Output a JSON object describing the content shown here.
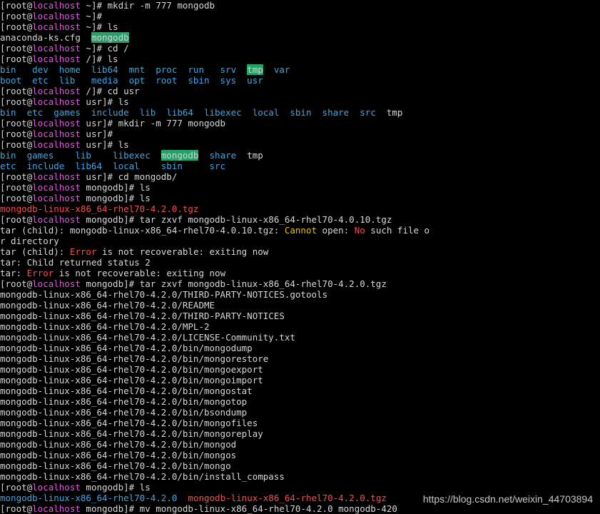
{
  "terminal": {
    "lines": [
      [
        {
          "t": "[root@"
        },
        {
          "t": "localhost",
          "c": "host"
        },
        {
          "t": " ~]# mkdir -m 777 mongodb"
        }
      ],
      [
        {
          "t": "[root@"
        },
        {
          "t": "localhost",
          "c": "host"
        },
        {
          "t": " ~]#"
        }
      ],
      [
        {
          "t": "[root@"
        },
        {
          "t": "localhost",
          "c": "host"
        },
        {
          "t": " ~]# ls"
        }
      ],
      [
        {
          "t": "anaconda-ks.cfg  "
        },
        {
          "t": "mongodb",
          "c": "hl"
        }
      ],
      [
        {
          "t": "[root@"
        },
        {
          "t": "localhost",
          "c": "host"
        },
        {
          "t": " ~]# cd /"
        }
      ],
      [
        {
          "t": "[root@"
        },
        {
          "t": "localhost",
          "c": "host"
        },
        {
          "t": " /]# ls"
        }
      ],
      [
        {
          "t": "bin   dev  home  lib64  mnt  proc  run   srv  ",
          "c": "dir"
        },
        {
          "t": "tmp",
          "c": "hl"
        },
        {
          "t": "  var",
          "c": "dir"
        }
      ],
      [
        {
          "t": "boot  etc  lib   media  opt  root  sbin  sys  usr",
          "c": "dir"
        }
      ],
      [
        {
          "t": "[root@"
        },
        {
          "t": "localhost",
          "c": "host"
        },
        {
          "t": " /]# cd usr"
        }
      ],
      [
        {
          "t": "[root@"
        },
        {
          "t": "localhost",
          "c": "host"
        },
        {
          "t": " usr]# ls"
        }
      ],
      [
        {
          "t": "bin  etc  games  include  lib  lib64  libexec  local  sbin  share  src  ",
          "c": "dir"
        },
        {
          "t": "tmp"
        }
      ],
      [
        {
          "t": "[root@"
        },
        {
          "t": "localhost",
          "c": "host"
        },
        {
          "t": " usr]# mkdir -m 777 mongodb"
        }
      ],
      [
        {
          "t": "[root@"
        },
        {
          "t": "localhost",
          "c": "host"
        },
        {
          "t": " usr]#"
        }
      ],
      [
        {
          "t": "[root@"
        },
        {
          "t": "localhost",
          "c": "host"
        },
        {
          "t": " usr]# ls"
        }
      ],
      [
        {
          "t": "bin  games    lib    libexec  ",
          "c": "dir"
        },
        {
          "t": "mongodb",
          "c": "hl"
        },
        {
          "t": "  share  ",
          "c": "dir"
        },
        {
          "t": "tmp"
        }
      ],
      [
        {
          "t": "etc  include  lib64  local    sbin     src",
          "c": "dir"
        }
      ],
      [
        {
          "t": "[root@"
        },
        {
          "t": "localhost",
          "c": "host"
        },
        {
          "t": " usr]# cd mongodb/"
        }
      ],
      [
        {
          "t": "[root@"
        },
        {
          "t": "localhost",
          "c": "host"
        },
        {
          "t": " mongodb]# ls"
        }
      ],
      [
        {
          "t": "[root@"
        },
        {
          "t": "localhost",
          "c": "host"
        },
        {
          "t": " mongodb]# ls"
        }
      ],
      [
        {
          "t": "mongodb-linux-x86_64-rhel70-4.2.0.tgz",
          "c": "err"
        }
      ],
      [
        {
          "t": "[root@"
        },
        {
          "t": "localhost",
          "c": "host"
        },
        {
          "t": " mongodb]# tar zxvf mongodb-linux-x86_64-rhel70-4.0.10.tgz"
        }
      ],
      [
        {
          "t": "tar (child): mongodb-linux-x86_64-rhel70-4.0.10.tgz: "
        },
        {
          "t": "Cannot",
          "c": "yellow"
        },
        {
          "t": " open: "
        },
        {
          "t": "No",
          "c": "red"
        },
        {
          "t": " such file o"
        }
      ],
      [
        {
          "t": "r directory"
        }
      ],
      [
        {
          "t": "tar (child): "
        },
        {
          "t": "Error",
          "c": "red"
        },
        {
          "t": " is not recoverable: exiting now"
        }
      ],
      [
        {
          "t": "tar: Child returned status 2"
        }
      ],
      [
        {
          "t": "tar: "
        },
        {
          "t": "Error",
          "c": "red"
        },
        {
          "t": " is not recoverable: exiting now"
        }
      ],
      [
        {
          "t": "[root@"
        },
        {
          "t": "localhost",
          "c": "host"
        },
        {
          "t": " mongodb]# tar zxvf mongodb-linux-x86_64-rhel70-4.2.0.tgz"
        }
      ],
      [
        {
          "t": "mongodb-linux-x86_64-rhel70-4.2.0/THIRD-PARTY-NOTICES.gotools"
        }
      ],
      [
        {
          "t": "mongodb-linux-x86_64-rhel70-4.2.0/README"
        }
      ],
      [
        {
          "t": "mongodb-linux-x86_64-rhel70-4.2.0/THIRD-PARTY-NOTICES"
        }
      ],
      [
        {
          "t": "mongodb-linux-x86_64-rhel70-4.2.0/MPL-2"
        }
      ],
      [
        {
          "t": "mongodb-linux-x86_64-rhel70-4.2.0/LICENSE-Community.txt"
        }
      ],
      [
        {
          "t": "mongodb-linux-x86_64-rhel70-4.2.0/bin/mongodump"
        }
      ],
      [
        {
          "t": "mongodb-linux-x86_64-rhel70-4.2.0/bin/mongorestore"
        }
      ],
      [
        {
          "t": "mongodb-linux-x86_64-rhel70-4.2.0/bin/mongoexport"
        }
      ],
      [
        {
          "t": "mongodb-linux-x86_64-rhel70-4.2.0/bin/mongoimport"
        }
      ],
      [
        {
          "t": "mongodb-linux-x86_64-rhel70-4.2.0/bin/mongostat"
        }
      ],
      [
        {
          "t": "mongodb-linux-x86_64-rhel70-4.2.0/bin/mongotop"
        }
      ],
      [
        {
          "t": "mongodb-linux-x86_64-rhel70-4.2.0/bin/bsondump"
        }
      ],
      [
        {
          "t": "mongodb-linux-x86_64-rhel70-4.2.0/bin/mongofiles"
        }
      ],
      [
        {
          "t": "mongodb-linux-x86_64-rhel70-4.2.0/bin/mongoreplay"
        }
      ],
      [
        {
          "t": "mongodb-linux-x86_64-rhel70-4.2.0/bin/mongod"
        }
      ],
      [
        {
          "t": "mongodb-linux-x86_64-rhel70-4.2.0/bin/mongos"
        }
      ],
      [
        {
          "t": "mongodb-linux-x86_64-rhel70-4.2.0/bin/mongo"
        }
      ],
      [
        {
          "t": "mongodb-linux-x86_64-rhel70-4.2.0/bin/install_compass"
        }
      ],
      [
        {
          "t": "[root@"
        },
        {
          "t": "localhost",
          "c": "host"
        },
        {
          "t": " mongodb]# ls"
        }
      ],
      [
        {
          "t": "mongodb-linux-x86_64-rhel70-4.2.0",
          "c": "dir"
        },
        {
          "t": "  "
        },
        {
          "t": "mongodb-linux-x86_64-rhel70-4.2.0.tgz",
          "c": "err"
        }
      ],
      [
        {
          "t": "[root@"
        },
        {
          "t": "localhost",
          "c": "host"
        },
        {
          "t": " mongodb]# mv mongodb-linux-x86_64-rhel70-4.2.0 mongodb-420"
        }
      ]
    ]
  },
  "watermark": "https://blog.csdn.net/weixin_44703894",
  "colors": {
    "background": "#000000",
    "text": "#d7d7d7",
    "host": "#d75fd7",
    "directory": "#3fa7e6",
    "highlight_bg": "#26a269",
    "error": "#f05050",
    "warning": "#e0c020"
  }
}
